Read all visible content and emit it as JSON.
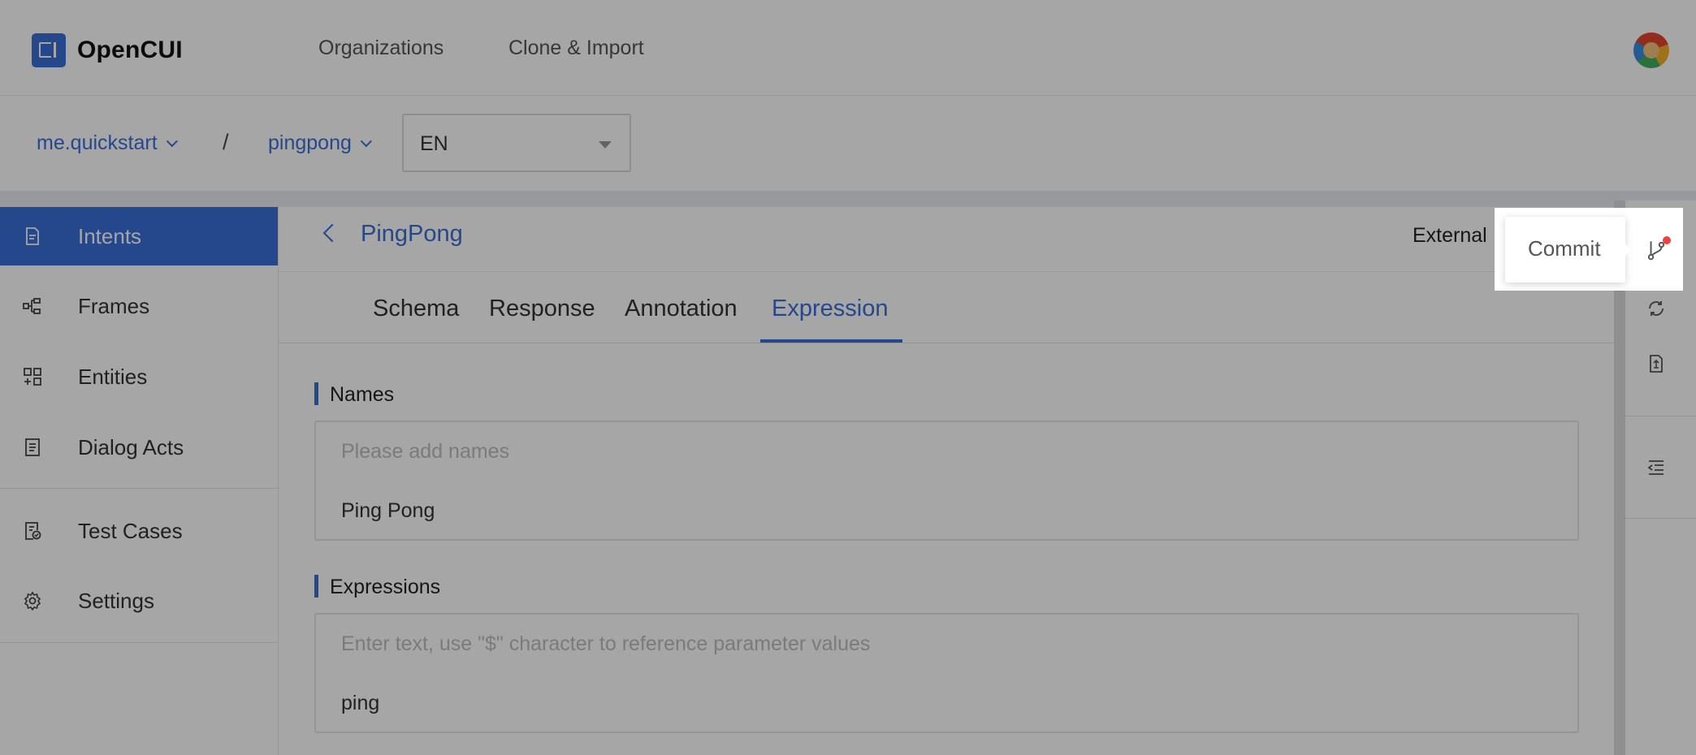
{
  "app": {
    "name": "OpenCUI"
  },
  "topnav": {
    "organizations": "Organizations",
    "clone_import": "Clone & Import"
  },
  "breadcrumb": {
    "org": "me.quickstart",
    "separator": "/",
    "project": "pingpong"
  },
  "language": {
    "selected": "EN"
  },
  "sidebar": {
    "items": [
      {
        "label": "Intents",
        "icon": "document-icon"
      },
      {
        "label": "Frames",
        "icon": "frames-icon"
      },
      {
        "label": "Entities",
        "icon": "entities-icon"
      },
      {
        "label": "Dialog Acts",
        "icon": "dialog-acts-icon"
      },
      {
        "label": "Test Cases",
        "icon": "test-cases-icon"
      },
      {
        "label": "Settings",
        "icon": "gear-icon"
      }
    ]
  },
  "page": {
    "title": "PingPong",
    "external_label": "External"
  },
  "tabs": [
    {
      "label": "Schema"
    },
    {
      "label": "Response"
    },
    {
      "label": "Annotation"
    },
    {
      "label": "Expression"
    }
  ],
  "active_tab": "Expression",
  "names": {
    "title": "Names",
    "placeholder": "Please add names",
    "entries": [
      "Ping Pong"
    ]
  },
  "expressions": {
    "title": "Expressions",
    "placeholder": "Enter text, use \"$\" character to reference parameter values",
    "entries": [
      "ping"
    ]
  },
  "tooltip": {
    "text": "Commit"
  },
  "colors": {
    "accent": "#3a6fd8",
    "notification": "#f0433f"
  }
}
